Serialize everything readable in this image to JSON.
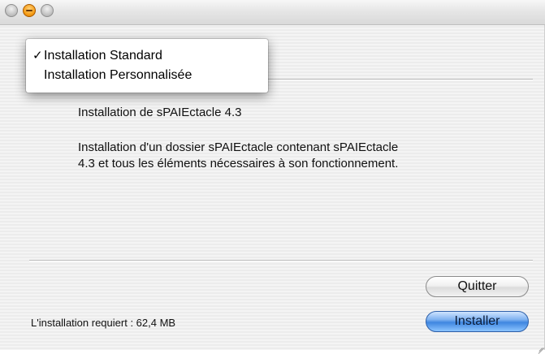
{
  "window": {
    "title_buttons": [
      "close",
      "minimize",
      "zoom"
    ]
  },
  "popup_menu": {
    "items": [
      {
        "label": "Installation Standard",
        "checked": true,
        "check_mark": "✓"
      },
      {
        "label": "Installation Personnalisée",
        "checked": false,
        "check_mark": ""
      }
    ]
  },
  "content": {
    "heading": "Installation de sPAIEctacle 4.3",
    "description_line1": "Installation d'un dossier sPAIEctacle contenant sPAIEctacle",
    "description_line2": "4.3 et tous les éléments nécessaires à son fonctionnement."
  },
  "footer": {
    "required_space": "L'installation requiert : 62,4 MB",
    "quit_label": "Quitter",
    "install_label": "Installer"
  },
  "colors": {
    "accent": "#3f86e0",
    "window_bg": "#ececec"
  }
}
